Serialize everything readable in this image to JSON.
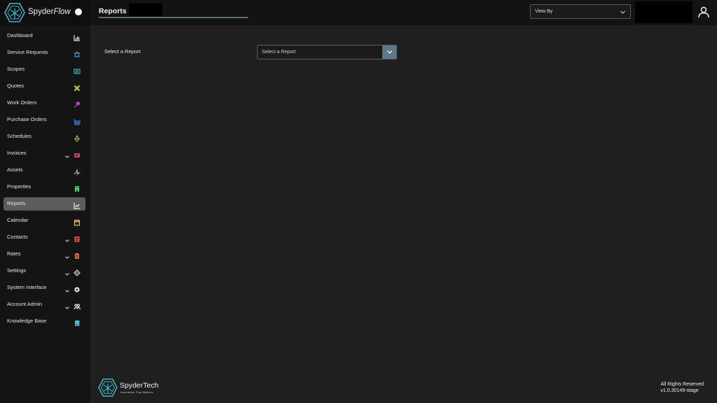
{
  "brand": {
    "name_main": "Spyder",
    "name_accent": "Flow"
  },
  "page": {
    "title": "Reports"
  },
  "view_by": {
    "label": "View By"
  },
  "sidebar": {
    "items": [
      {
        "label": "Dashboard",
        "icon": "bar-chart-icon",
        "color": "#e8e8e8",
        "chevron": false,
        "active": false
      },
      {
        "label": "Service Requests",
        "icon": "service-request-icon",
        "color": "#4a8fd6",
        "chevron": false,
        "active": false
      },
      {
        "label": "Scopes",
        "icon": "scope-icon",
        "color": "#2fb9b0",
        "chevron": false,
        "active": false
      },
      {
        "label": "Quotes",
        "icon": "tools-icon",
        "color": "#a8d84a",
        "chevron": false,
        "active": false
      },
      {
        "label": "Work Orders",
        "icon": "hammer-icon",
        "color": "#c23fd9",
        "chevron": false,
        "active": false
      },
      {
        "label": "Purchase Orders",
        "icon": "cart-icon",
        "color": "#3a7bd8",
        "chevron": false,
        "active": false
      },
      {
        "label": "Schedules",
        "icon": "recycle-icon",
        "color": "#9bcf4a",
        "chevron": false,
        "active": false
      },
      {
        "label": "Invoices",
        "icon": "invoice-icon",
        "color": "#e0457a",
        "chevron": true,
        "active": false
      },
      {
        "label": "Assets",
        "icon": "pulse-icon",
        "color": "#b0b0b0",
        "chevron": false,
        "active": false
      },
      {
        "label": "Properties",
        "icon": "building-icon",
        "color": "#4ccf6a",
        "chevron": false,
        "active": false
      },
      {
        "label": "Reports",
        "icon": "line-chart-icon",
        "color": "#e8e8e8",
        "chevron": false,
        "active": true
      },
      {
        "label": "Calendar",
        "icon": "calendar-icon",
        "color": "#e8c45a",
        "chevron": false,
        "active": false
      },
      {
        "label": "Contacts",
        "icon": "contact-book-icon",
        "color": "#e04a4a",
        "chevron": true,
        "active": false
      },
      {
        "label": "Rates",
        "icon": "clipboard-icon",
        "color": "#e0683a",
        "chevron": true,
        "active": false
      },
      {
        "label": "Settings",
        "icon": "gear-icon",
        "color": "#e8e8e8",
        "chevron": true,
        "active": false
      },
      {
        "label": "System Interface",
        "icon": "system-gear-icon",
        "color": "#e8e8e8",
        "chevron": true,
        "active": false
      },
      {
        "label": "Account Admin",
        "icon": "users-icon",
        "color": "#e8e8e8",
        "chevron": true,
        "active": false
      },
      {
        "label": "Knowledge Base",
        "icon": "book-icon",
        "color": "#3fc1d6",
        "chevron": false,
        "active": false
      }
    ]
  },
  "main": {
    "report_label": "Select a Report",
    "report_select_placeholder": "Select a Report"
  },
  "footer": {
    "brand": "SpyderTech",
    "tagline": "Innovation That Matters",
    "rights": "All Rights Reserved",
    "version": "v1.0.30149-stage"
  },
  "colors": {
    "accent": "#5d7886",
    "logo": "#3fb8c9",
    "active_item": "#5d5d5d"
  }
}
